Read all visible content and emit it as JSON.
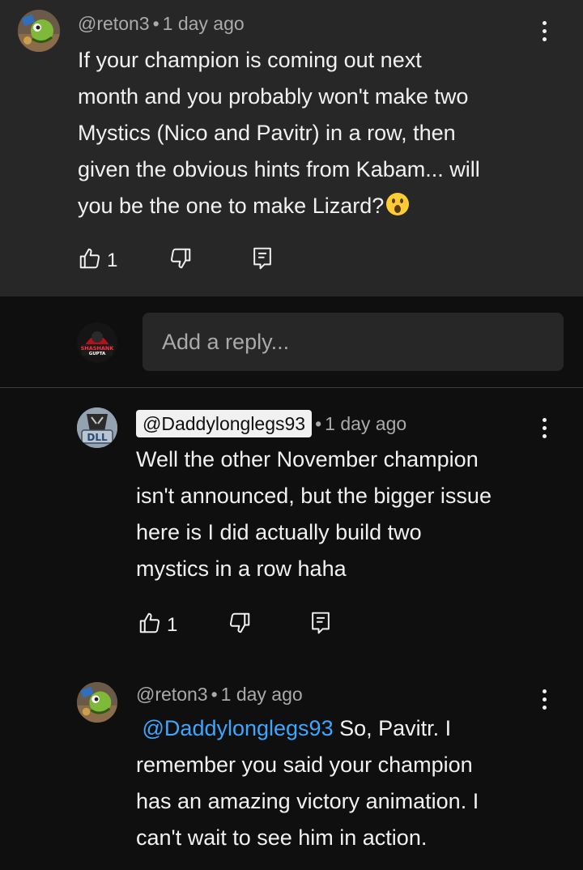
{
  "comments": {
    "top": {
      "author": "@reton3",
      "time": "1 day ago",
      "separator": "•",
      "lines": [
        "If your champion is coming out next",
        "month and you probably won't make two",
        "Mystics (Nico and Pavitr) in a row, then",
        "given the obvious hints from Kabam... will",
        "you be the one to make Lizard?"
      ],
      "likes": "1"
    },
    "reply_input": {
      "placeholder": "Add a reply...",
      "avatar_text_1": "SHASHANK",
      "avatar_text_2": "GUPTA"
    },
    "reply1": {
      "author": "@Daddylonglegs93",
      "time": "1 day ago",
      "separator": "•",
      "avatar_text": "DLL",
      "lines": [
        "Well the other November champion",
        "isn't announced, but the bigger issue",
        "here is I did actually build two",
        "mystics in a row haha"
      ],
      "likes": "1"
    },
    "reply2": {
      "author": "@reton3",
      "time": "1 day ago",
      "separator": "•",
      "mention": "@Daddylonglegs93",
      "first_line_rest": " So, Pavitr. I",
      "lines": [
        "remember you said your champion",
        "has an amazing victory animation. I",
        "can't wait to see him in action."
      ]
    }
  },
  "icons": {
    "like": "thumbs-up-icon",
    "dislike": "thumbs-down-icon",
    "reply": "reply-comment-icon",
    "more": "more-vertical-icon",
    "emoji": "surprised-face-emoji"
  },
  "colors": {
    "background": "#0f0f0f",
    "highlight_bg": "#272727",
    "text": "#f1f1f1",
    "meta": "#aaaaaa",
    "mention": "#3ea6ff",
    "chip_bg": "#f1f1f1"
  }
}
